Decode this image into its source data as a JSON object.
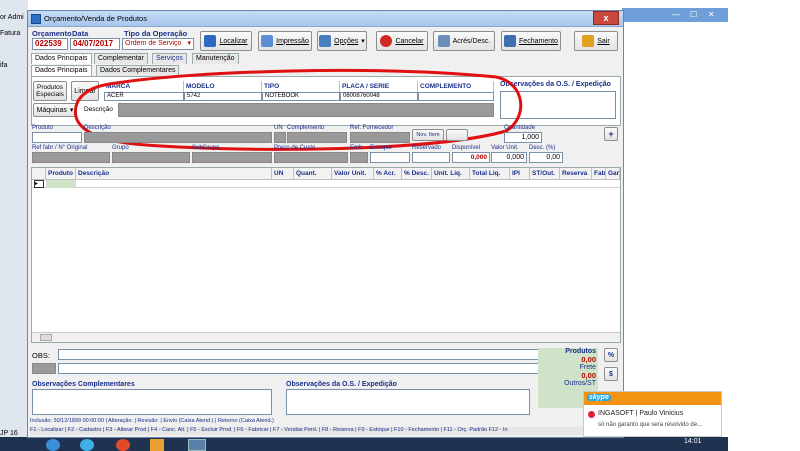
{
  "background": {
    "left_texts": [
      "or Admi",
      "Fatura",
      "ifa",
      "JP 16"
    ],
    "window_controls": [
      "—",
      "☐",
      "✕"
    ]
  },
  "window": {
    "title": "Orçamento/Venda de Produtos",
    "close_label": "x"
  },
  "header": {
    "orcamento_label": "Orçamento",
    "data_label": "Data",
    "tipo_label": "Tipo da Operação",
    "orcamento_value": "022539",
    "data_value": "04/07/2017",
    "tipo_value": "Ordem de Serviço"
  },
  "toolbar": [
    {
      "label": "Localizar",
      "icon": "binoculars-icon",
      "color": "#2e68c0"
    },
    {
      "label": "Impressão",
      "icon": "printer-icon",
      "color": "#5a8fd6"
    },
    {
      "label": "Opções",
      "icon": "options-icon",
      "color": "#4a7fbd"
    },
    {
      "label": "Cancelar",
      "icon": "cancel-icon",
      "color": "#d02a20"
    },
    {
      "label": "Acrés/Desc.",
      "icon": "tag-icon",
      "color": "#6b8fb8"
    },
    {
      "label": "Fechamento",
      "icon": "close-sale-icon",
      "color": "#3c6eb0"
    },
    {
      "label": "Sair",
      "icon": "exit-icon",
      "color": "#e0a020"
    }
  ],
  "tabs_main": [
    "Dados Principais",
    "Complementar",
    "Serviços",
    "Manutenção"
  ],
  "tabs_sub": [
    "Dados Principais",
    "Dados Complementares"
  ],
  "equipment": {
    "side_buttons": [
      "Produtos Especiais",
      "Limpar",
      "Máquinas",
      "Descrição"
    ],
    "columns": [
      "MARCA",
      "MODELO",
      "TIPO",
      "PLACA / SERIE",
      "COMPLEMENTO"
    ],
    "row": [
      "ACER",
      "5742",
      "NOTEBOOK",
      "06008760048",
      ""
    ],
    "obs_label": "Observações da O.S. / Expedição"
  },
  "product_fields": {
    "row1_labels": [
      "Produto",
      "Descrição",
      "UN",
      "Complemento",
      "Ref. Fornecedor",
      "Quantidade"
    ],
    "nov_item": "Nov. Item",
    "quantidade": "1,000",
    "row2_labels": [
      "Ref fabr / N° Original",
      "Grupo",
      "SubGrupo",
      "Preço de Custo",
      "Emb.",
      "Estoque",
      "Reservado",
      "Disponível",
      "Valor Unit.",
      "Desc. (%)"
    ],
    "disponivel": "0,000",
    "valor_unit": "0,000",
    "desc": "0,00",
    "add_label": "+"
  },
  "grid": {
    "columns": [
      "Produto",
      "Descrição",
      "UN",
      "Quant.",
      "Valor Unit.",
      "% Acr.",
      "% Desc.",
      "Unit. Liq.",
      "Total Liq.",
      "IPI",
      "ST/Out.",
      "Reserva",
      "Fab",
      "Gar"
    ]
  },
  "footer": {
    "obs_label": "OBS:",
    "produtos_label": "Produtos",
    "produtos_value": "0,00",
    "frete_label": "Frete",
    "frete_value": "0,00",
    "outros_label": "Outros/ST",
    "total_label": "To",
    "pct_label": "%",
    "dollar_label": "$",
    "obs_complementares": "Observações Complementares",
    "obs_os": "Observações da O.S. / Expedição",
    "status": "Inclusão: 30/12/1899 00:00:00 | Alteração: | Revisão: | Envio (Caixa Atend.) | Retorno (Caixa Atend.)",
    "shortcuts": "F1 - Localizar | F2 - Cadastro | F3 - Alterar Prod | F4 - Canc. Alt. | F5 - Excluir Prod. | F6 - Fabricar | F7 - Vendas Perd. | F8 - Reserva | F9 - Estoque | F10 - Fechamento | F11 - Orç. Padrão F12 - In"
  },
  "notification": {
    "app": "skype",
    "title": "INGASOFT | Paulo Vinicius",
    "message": "só não garanto que sera resolvido de..."
  },
  "taskbar": {
    "time": "14:01"
  },
  "colors": {
    "highlight_circle": "#e01010",
    "label_blue": "#1a2f8a",
    "value_red": "#b50000",
    "notification_orange": "#f39314"
  }
}
